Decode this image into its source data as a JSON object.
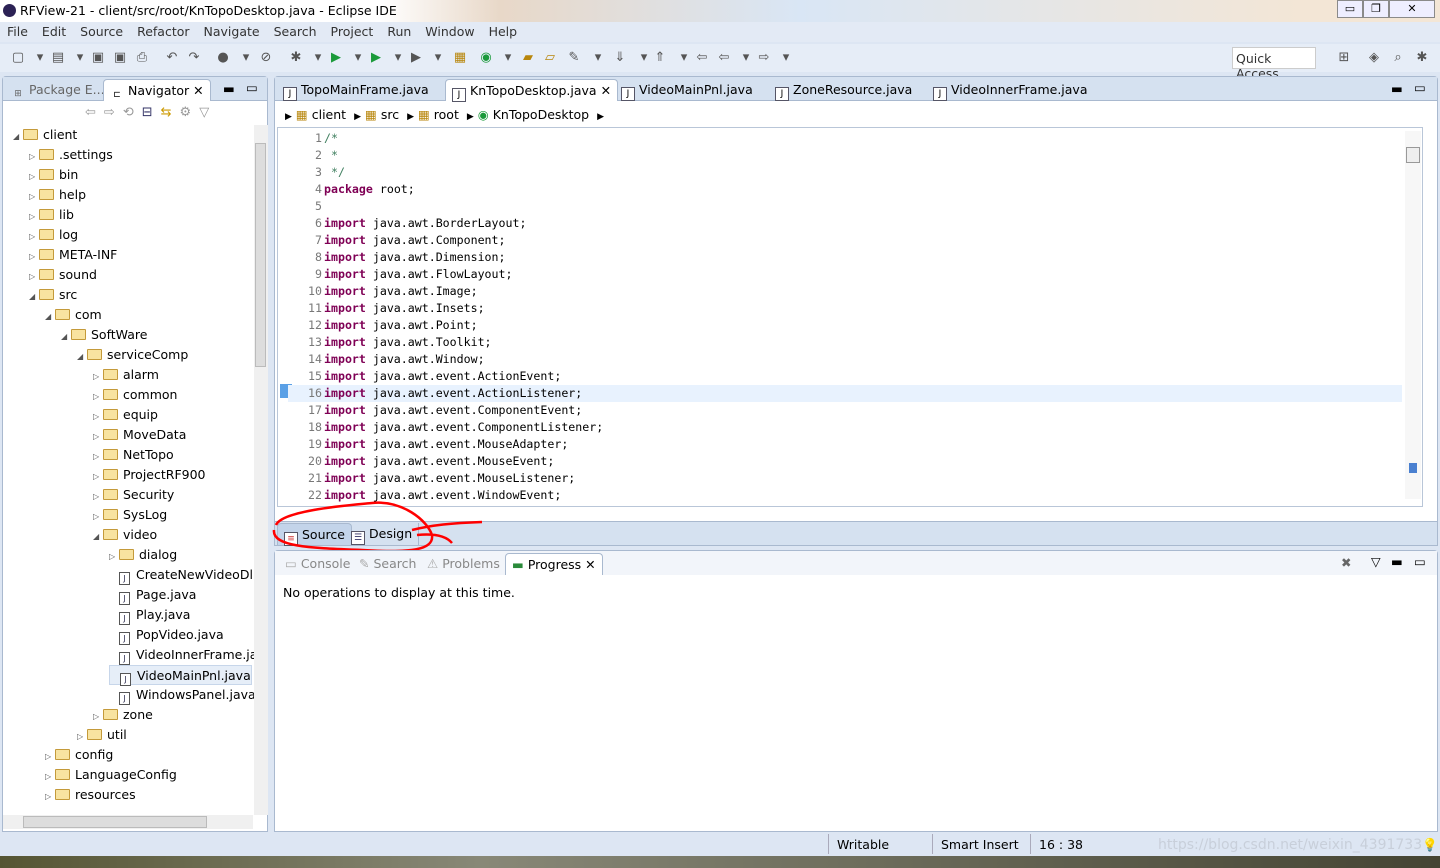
{
  "window": {
    "title": "RFView-21 - client/src/root/KnTopoDesktop.java - Eclipse IDE"
  },
  "menu": [
    "File",
    "Edit",
    "Source",
    "Refactor",
    "Navigate",
    "Search",
    "Project",
    "Run",
    "Window",
    "Help"
  ],
  "toolbar": {
    "quick_access": "Quick Access"
  },
  "left_panel": {
    "tabs": [
      {
        "label": "Package E..."
      },
      {
        "label": "Navigator"
      }
    ],
    "tree": [
      {
        "label": "client",
        "level": 0,
        "type": "folder",
        "open": true
      },
      {
        "label": ".settings",
        "level": 1,
        "type": "folder"
      },
      {
        "label": "bin",
        "level": 1,
        "type": "folder"
      },
      {
        "label": "help",
        "level": 1,
        "type": "folder"
      },
      {
        "label": "lib",
        "level": 1,
        "type": "folder"
      },
      {
        "label": "log",
        "level": 1,
        "type": "folder"
      },
      {
        "label": "META-INF",
        "level": 1,
        "type": "folder"
      },
      {
        "label": "sound",
        "level": 1,
        "type": "folder"
      },
      {
        "label": "src",
        "level": 1,
        "type": "folder",
        "open": true
      },
      {
        "label": "com",
        "level": 2,
        "type": "folder",
        "open": true
      },
      {
        "label": "SoftWare",
        "level": 3,
        "type": "folder",
        "open": true
      },
      {
        "label": "serviceComp",
        "level": 4,
        "type": "folder",
        "open": true
      },
      {
        "label": "alarm",
        "level": 5,
        "type": "folder"
      },
      {
        "label": "common",
        "level": 5,
        "type": "folder"
      },
      {
        "label": "equip",
        "level": 5,
        "type": "folder"
      },
      {
        "label": "MoveData",
        "level": 5,
        "type": "folder"
      },
      {
        "label": "NetTopo",
        "level": 5,
        "type": "folder"
      },
      {
        "label": "ProjectRF900",
        "level": 5,
        "type": "folder"
      },
      {
        "label": "Security",
        "level": 5,
        "type": "folder"
      },
      {
        "label": "SysLog",
        "level": 5,
        "type": "folder"
      },
      {
        "label": "video",
        "level": 5,
        "type": "folder",
        "open": true
      },
      {
        "label": "dialog",
        "level": 6,
        "type": "folder"
      },
      {
        "label": "CreateNewVideoDl",
        "level": 6,
        "type": "file"
      },
      {
        "label": "Page.java",
        "level": 6,
        "type": "file"
      },
      {
        "label": "Play.java",
        "level": 6,
        "type": "file"
      },
      {
        "label": "PopVideo.java",
        "level": 6,
        "type": "file"
      },
      {
        "label": "VideoInnerFrame.ja",
        "level": 6,
        "type": "file"
      },
      {
        "label": "VideoMainPnl.java",
        "level": 6,
        "type": "file",
        "selected": true
      },
      {
        "label": "WindowsPanel.java",
        "level": 6,
        "type": "file"
      },
      {
        "label": "zone",
        "level": 5,
        "type": "folder"
      },
      {
        "label": "util",
        "level": 4,
        "type": "folder"
      },
      {
        "label": "config",
        "level": 2,
        "type": "folder"
      },
      {
        "label": "LanguageConfig",
        "level": 2,
        "type": "folder"
      },
      {
        "label": "resources",
        "level": 2,
        "type": "folder"
      }
    ]
  },
  "editor": {
    "tabs": [
      {
        "label": "TopoMainFrame.java"
      },
      {
        "label": "KnTopoDesktop.java",
        "active": true
      },
      {
        "label": "VideoMainPnl.java"
      },
      {
        "label": "ZoneResource.java"
      },
      {
        "label": "VideoInnerFrame.java"
      }
    ],
    "breadcrumb": [
      "client",
      "src",
      "root",
      "KnTopoDesktop"
    ],
    "lines": [
      {
        "n": "1",
        "code": "/*",
        "t": "cm"
      },
      {
        "n": "2",
        "code": " *",
        "t": "cm"
      },
      {
        "n": "3",
        "code": " */",
        "t": "cm"
      },
      {
        "n": "4",
        "kw": "package",
        "code": " root;"
      },
      {
        "n": "5",
        "code": ""
      },
      {
        "n": "6",
        "kw": "import",
        "code": " java.awt.BorderLayout;"
      },
      {
        "n": "7",
        "kw": "import",
        "code": " java.awt.Component;"
      },
      {
        "n": "8",
        "kw": "import",
        "code": " java.awt.Dimension;"
      },
      {
        "n": "9",
        "kw": "import",
        "code": " java.awt.FlowLayout;"
      },
      {
        "n": "10",
        "kw": "import",
        "code": " java.awt.Image;"
      },
      {
        "n": "11",
        "kw": "import",
        "code": " java.awt.Insets;"
      },
      {
        "n": "12",
        "kw": "import",
        "code": " java.awt.Point;"
      },
      {
        "n": "13",
        "kw": "import",
        "code": " java.awt.Toolkit;"
      },
      {
        "n": "14",
        "kw": "import",
        "code": " java.awt.Window;"
      },
      {
        "n": "15",
        "kw": "import",
        "code": " java.awt.event.ActionEvent;"
      },
      {
        "n": "16",
        "kw": "import",
        "code": " java.awt.event.ActionListener;",
        "current": true
      },
      {
        "n": "17",
        "kw": "import",
        "code": " java.awt.event.ComponentEvent;"
      },
      {
        "n": "18",
        "kw": "import",
        "code": " java.awt.event.ComponentListener;"
      },
      {
        "n": "19",
        "kw": "import",
        "code": " java.awt.event.MouseAdapter;"
      },
      {
        "n": "20",
        "kw": "import",
        "code": " java.awt.event.MouseEvent;"
      },
      {
        "n": "21",
        "kw": "import",
        "code": " java.awt.event.MouseListener;"
      },
      {
        "n": "22",
        "kw": "import",
        "code": " java.awt.event.WindowEvent;"
      }
    ],
    "bottom_tabs": [
      "Source",
      "Design"
    ]
  },
  "bottom_panel": {
    "tabs": [
      {
        "label": "Console"
      },
      {
        "label": "Search"
      },
      {
        "label": "Problems"
      },
      {
        "label": "Progress",
        "active": true
      }
    ],
    "message": "No operations to display at this time."
  },
  "status": {
    "writable": "Writable",
    "insert_mode": "Smart Insert",
    "position": "16 : 38"
  },
  "watermark": "https://blog.csdn.net/weixin_4391733",
  "colors": {
    "keyword": "#7f0055",
    "comment": "#3f7f5f",
    "annotation": "#ff0000"
  }
}
